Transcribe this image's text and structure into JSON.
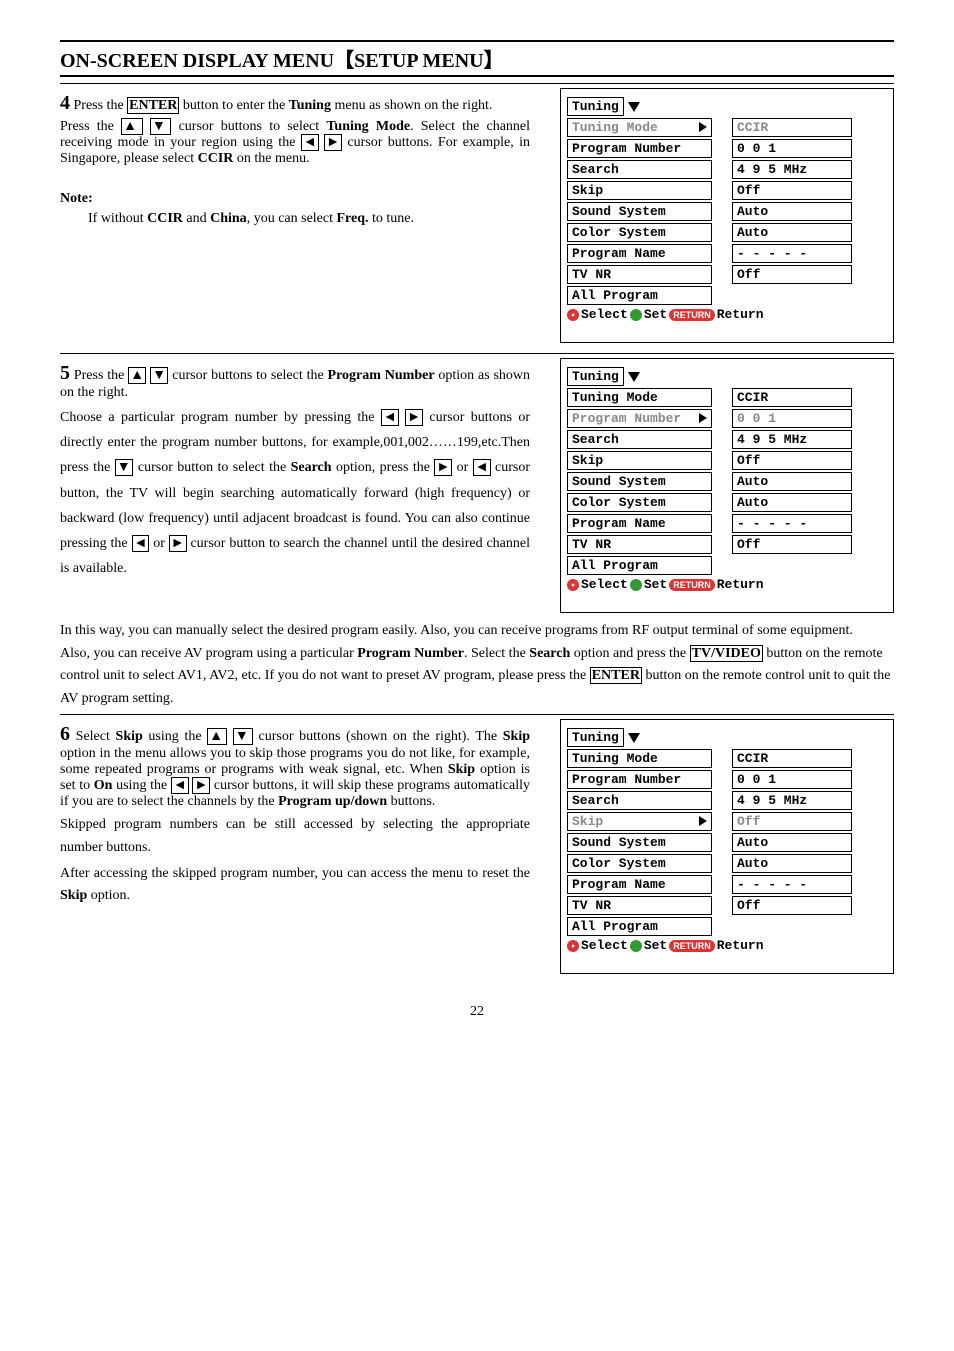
{
  "title": "ON-SCREEN DISPLAY MENU【SETUP MENU】",
  "page_number": "22",
  "step4": {
    "num": "4",
    "text1a": "Press the ",
    "enter": "ENTER",
    "text1b": " button to enter the ",
    "bold1": "Tuning",
    "text1c": " menu as shown on the right.",
    "text2a": "Press the ",
    "text2b": " cursor buttons to select ",
    "bold2": "Tuning Mode",
    "text2c": ". Select the channel receiving mode in your region using the ",
    "text2d": " cursor buttons. For example, in Singapore, please select ",
    "bold3": "CCIR",
    "text2e": " on the menu.",
    "note_head": "Note:",
    "note_a": "If without ",
    "note_b1": "CCIR",
    "note_c": " and ",
    "note_b2": "China",
    "note_d": ", you can select ",
    "note_b3": "Freq.",
    "note_e": " to tune."
  },
  "step5": {
    "num": "5",
    "t1": "Press the ",
    "t2": " cursor buttons to select the ",
    "b1": "Program Number",
    "t3": " option as shown on the right.",
    "t4": "Choose a particular program number by pressing the ",
    "t5": " cursor buttons or directly enter the program number buttons, for example,001,002……199,etc.Then press the ",
    "t6": " cursor button to select the ",
    "b2": "Search",
    "t7": " option, press the ",
    "t8": " or ",
    "t9": " cursor button, the TV will begin searching automatically forward (high frequency) or backward (low frequency) until adjacent broadcast is found. You can also continue pressing the ",
    "t10": " or ",
    "t11": " cursor button to search the channel until the desired channel is available.",
    "t12": "In this way, you can manually select the desired program easily. Also, you can receive programs from RF output terminal of some equipment.",
    "t13a": "Also, you can receive AV program using a particular ",
    "b3": "Program Number",
    "t13b": ". Select the ",
    "b4": "Search",
    "t13c": " option and press the ",
    "tv": "TV/VIDEO",
    "t13d": " button on the remote control unit to select AV1, AV2, etc. If you do not want to preset AV program, please press the ",
    "enter": "ENTER",
    "t13e": " button on the remote control unit to quit the AV program setting."
  },
  "step6": {
    "num": "6",
    "t1": "Select ",
    "b1": "Skip",
    "t2": " using the ",
    "t3": " cursor buttons (shown on the right). The ",
    "b2": "Skip",
    "t4": " option in the menu allows you to skip those programs you do not like, for example, some repeated programs or programs with weak signal, etc. When ",
    "b3": "Skip",
    "t5": " option is set to ",
    "b4": "On",
    "t6": " using the ",
    "t7": " cursor buttons, it will skip these programs automatically if you are to select the channels by the ",
    "b5": "Program up/down",
    "t8": " buttons.",
    "t9": "Skipped program numbers can be still accessed by selecting the appropriate number buttons.",
    "t10": "After accessing the skipped program number, you can access the menu to reset the ",
    "b6": "Skip",
    "t11": " option."
  },
  "menu": {
    "header": "Tuning",
    "rows": [
      {
        "label": "Tuning Mode",
        "value": "CCIR"
      },
      {
        "label": "Program Number",
        "value": "0 0 1"
      },
      {
        "label": "Search",
        "value": "4 9 5 MHz"
      },
      {
        "label": "Skip",
        "value": "Off"
      },
      {
        "label": "Sound System",
        "value": "Auto"
      },
      {
        "label": "Color System",
        "value": "Auto"
      },
      {
        "label": "Program Name",
        "value": "- - - - -"
      },
      {
        "label": "TV NR",
        "value": "Off"
      },
      {
        "label": "All Program",
        "value": null
      }
    ],
    "footer_select": "Select",
    "footer_set": "Set",
    "footer_return_pill": "RETURN",
    "footer_return": "Return"
  },
  "m1_active": 0,
  "m1_val0": "CCIR",
  "m2_active": 1,
  "m2_val1": "0 0 1",
  "m3_active": 3,
  "m3_val3": "Off"
}
